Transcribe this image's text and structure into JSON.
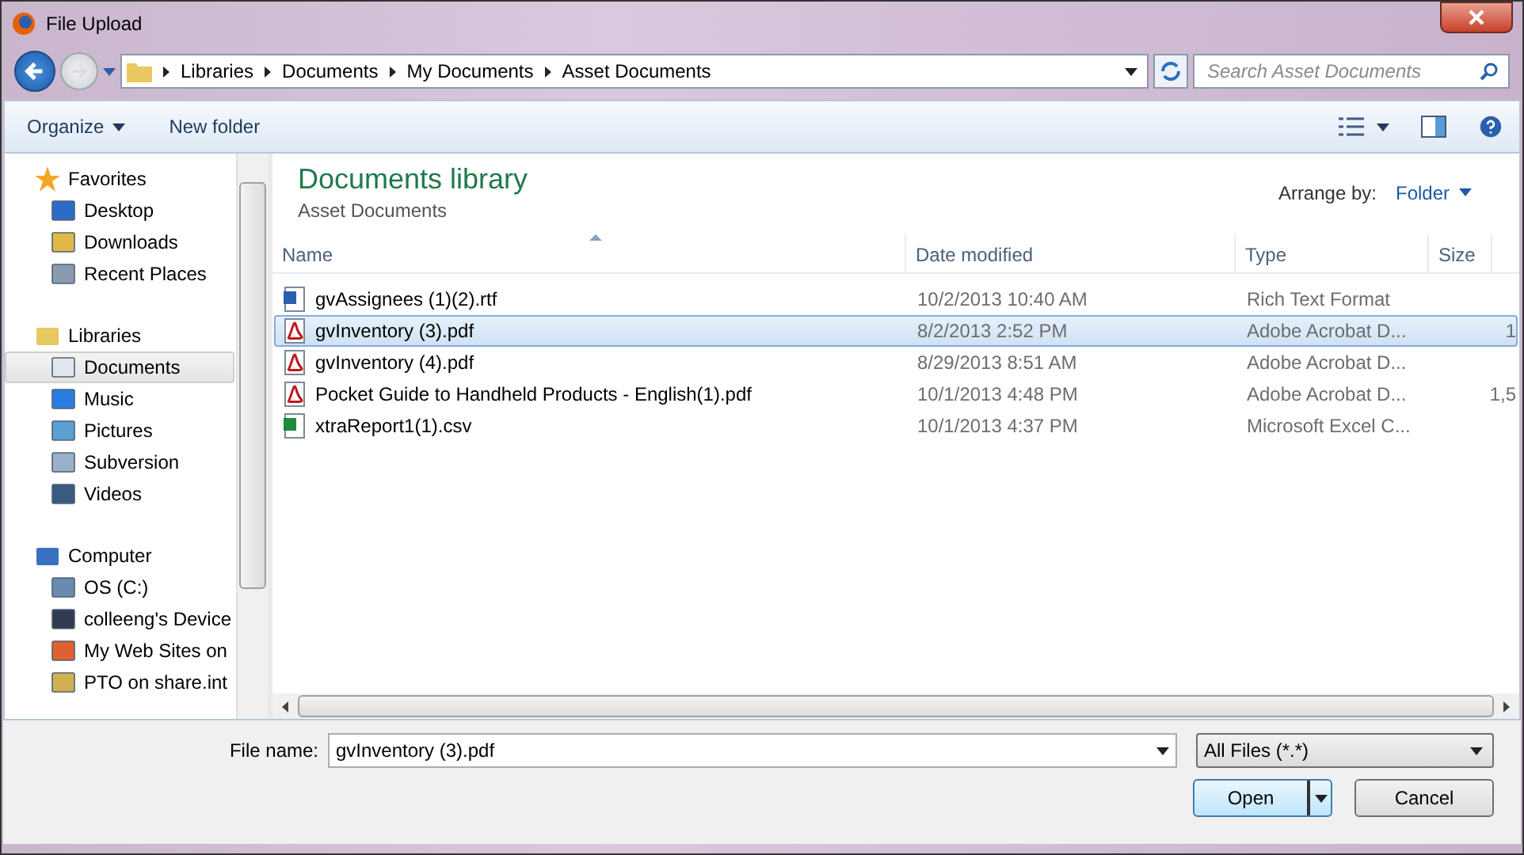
{
  "window": {
    "title": "File Upload"
  },
  "address": {
    "crumbs": [
      "Libraries",
      "Documents",
      "My Documents",
      "Asset Documents"
    ]
  },
  "search": {
    "placeholder": "Search Asset Documents"
  },
  "toolbar": {
    "organize": "Organize",
    "new_folder": "New folder"
  },
  "sidebar": {
    "groups": [
      {
        "label": "Favorites",
        "selected": false,
        "children": [
          {
            "label": "Desktop",
            "selected": false
          },
          {
            "label": "Downloads",
            "selected": false
          },
          {
            "label": "Recent Places",
            "selected": false
          }
        ]
      },
      {
        "label": "Libraries",
        "selected": false,
        "children": [
          {
            "label": "Documents",
            "selected": true
          },
          {
            "label": "Music",
            "selected": false
          },
          {
            "label": "Pictures",
            "selected": false
          },
          {
            "label": "Subversion",
            "selected": false
          },
          {
            "label": "Videos",
            "selected": false
          }
        ]
      },
      {
        "label": "Computer",
        "selected": false,
        "children": [
          {
            "label": "OS (C:)",
            "selected": false
          },
          {
            "label": "colleeng's Device",
            "selected": false
          },
          {
            "label": "My Web Sites on",
            "selected": false
          },
          {
            "label": "PTO on share.int",
            "selected": false
          }
        ]
      }
    ]
  },
  "library": {
    "title": "Documents library",
    "subtitle": "Asset Documents",
    "arrange_label": "Arrange by:",
    "arrange_value": "Folder"
  },
  "table": {
    "columns": [
      {
        "label": "Name",
        "sorted": true
      },
      {
        "label": "Date modified",
        "sorted": false
      },
      {
        "label": "Type",
        "sorted": false
      },
      {
        "label": "Size",
        "sorted": false
      }
    ],
    "rows": [
      {
        "kind": "rtf",
        "name": "gvAssignees (1)(2).rtf",
        "date": "10/2/2013 10:40 AM",
        "type": "Rich Text Format",
        "selected": false
      },
      {
        "kind": "pdf",
        "name": "gvInventory (3).pdf",
        "date": "8/2/2013 2:52 PM",
        "type": "Adobe Acrobat D...",
        "size": "1",
        "selected": true
      },
      {
        "kind": "pdf",
        "name": "gvInventory (4).pdf",
        "date": "8/29/2013 8:51 AM",
        "type": "Adobe Acrobat D...",
        "selected": false
      },
      {
        "kind": "pdf",
        "name": "Pocket Guide to Handheld Products - English(1).pdf",
        "date": "10/1/2013 4:48 PM",
        "type": "Adobe Acrobat D...",
        "size": "1,5",
        "selected": false
      },
      {
        "kind": "csv",
        "name": "xtraReport1(1).csv",
        "date": "10/1/2013 4:37 PM",
        "type": "Microsoft Excel C...",
        "selected": false
      }
    ]
  },
  "footer": {
    "file_name_label": "File name:",
    "file_name": "gvInventory (3).pdf",
    "filter": "All Files (*.*)",
    "open": "Open",
    "cancel": "Cancel"
  }
}
